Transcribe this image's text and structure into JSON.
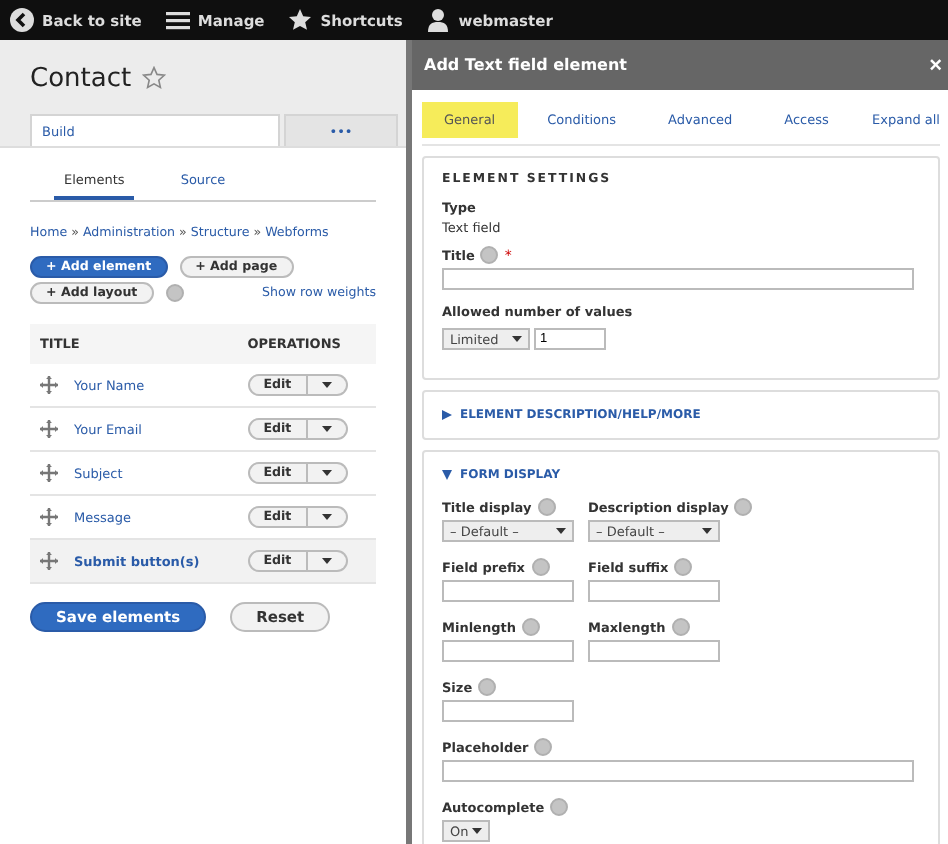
{
  "toolbar": [
    {
      "label": "Back to site",
      "kind": "back"
    },
    {
      "label": "Manage",
      "kind": "menu"
    },
    {
      "label": "Shortcuts",
      "kind": "star"
    },
    {
      "label": "webmaster",
      "kind": "user"
    }
  ],
  "page": {
    "title": "Contact",
    "favorite": false,
    "tabs": [
      {
        "label": "Build",
        "selected": true
      },
      {
        "label": "•••",
        "selected": false
      }
    ],
    "secondary_tabs": [
      {
        "label": "Elements",
        "selected": true
      },
      {
        "label": "Source",
        "selected": false
      }
    ],
    "breadcrumb": [
      "Home",
      "Administration",
      "Structure",
      "Webforms"
    ],
    "breadcrumb_separator": "»",
    "actions": [
      {
        "label": "+ Add element",
        "kind": "primary"
      },
      {
        "label": "+ Add page",
        "kind": "default"
      },
      {
        "label": "+ Add layout",
        "kind": "default"
      }
    ],
    "row_weights_link": "Show row weights",
    "table": {
      "columns": [
        "TITLE",
        "OPERATIONS"
      ],
      "rows": [
        {
          "title": "Your Name",
          "kind": "element",
          "operation": "Edit"
        },
        {
          "title": "Your Email",
          "kind": "element",
          "operation": "Edit"
        },
        {
          "title": "Subject",
          "kind": "element",
          "operation": "Edit"
        },
        {
          "title": "Message",
          "kind": "element",
          "operation": "Edit"
        },
        {
          "title": "Submit button(s)",
          "kind": "actions",
          "operation": "Edit"
        }
      ]
    },
    "buttons": [
      {
        "label": "Save elements",
        "kind": "primary"
      },
      {
        "label": "Reset",
        "kind": "default"
      }
    ]
  },
  "dialog": {
    "title": "Add Text field element",
    "close": "×",
    "tabs": [
      {
        "label": "General",
        "selected": true
      },
      {
        "label": "Conditions",
        "selected": false
      },
      {
        "label": "Advanced",
        "selected": false
      },
      {
        "label": "Access",
        "selected": false
      }
    ],
    "expand_all": "Expand all",
    "settings": {
      "heading": "ELEMENT SETTINGS",
      "type_label": "Type",
      "type_value": "Text field",
      "title_label": "Title",
      "title_required": "*",
      "allowed_label": "Allowed number of values",
      "allowed_select": "Limited",
      "allowed_value": "1"
    },
    "sections": [
      {
        "heading": "ELEMENT DESCRIPTION/HELP/MORE",
        "expanded": false
      },
      {
        "heading": "FORM DISPLAY",
        "expanded": true
      }
    ],
    "form_display": [
      [
        {
          "label": "Title display",
          "kind": "select",
          "value": "– Default –"
        },
        {
          "label": "Description display",
          "kind": "select",
          "value": "– Default –"
        }
      ],
      [
        {
          "label": "Field prefix",
          "kind": "text"
        },
        {
          "label": "Field suffix",
          "kind": "text"
        }
      ],
      [
        {
          "label": "Minlength",
          "kind": "text"
        },
        {
          "label": "Maxlength",
          "kind": "text"
        }
      ],
      [
        {
          "label": "Size",
          "kind": "text"
        }
      ],
      [
        {
          "label": "Placeholder",
          "kind": "wide"
        }
      ],
      [
        {
          "label": "Autocomplete",
          "kind": "small-select",
          "value": "On"
        }
      ]
    ]
  }
}
